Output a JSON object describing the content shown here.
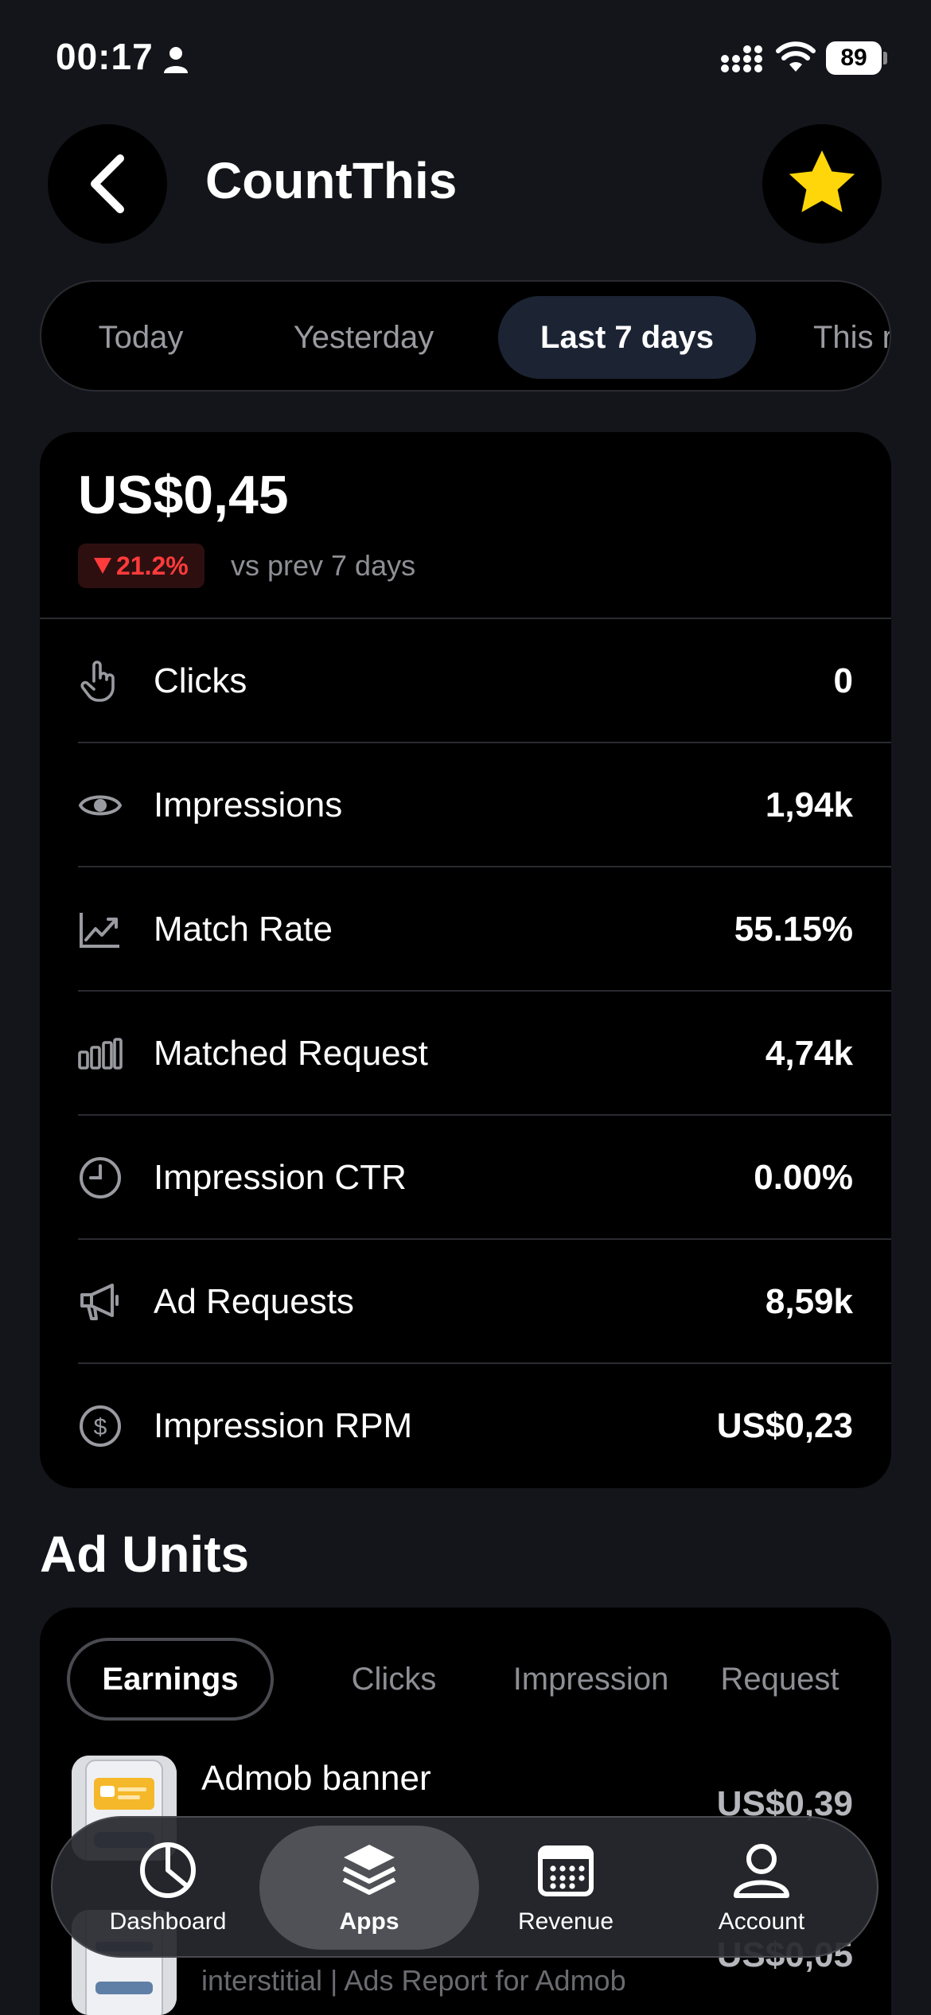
{
  "status_bar": {
    "time": "00:17",
    "battery": "89"
  },
  "header": {
    "title": "CountThis"
  },
  "period_tabs": [
    {
      "label": "Today"
    },
    {
      "label": "Yesterday"
    },
    {
      "label": "Last 7 days"
    },
    {
      "label": "This r"
    }
  ],
  "summary": {
    "amount": "US$0,45",
    "change": "21.2%",
    "change_direction": "down",
    "change_color": "#ff3b3b",
    "caption": "vs prev 7 days"
  },
  "metrics": [
    {
      "icon": "pointer-hand-icon",
      "label": "Clicks",
      "value": "0"
    },
    {
      "icon": "eye-icon",
      "label": "Impressions",
      "value": "1,94k"
    },
    {
      "icon": "trend-chart-icon",
      "label": "Match Rate",
      "value": "55.15%"
    },
    {
      "icon": "bars-icon",
      "label": "Matched Request",
      "value": "4,74k"
    },
    {
      "icon": "clock-icon",
      "label": "Impression CTR",
      "value": "0.00%"
    },
    {
      "icon": "megaphone-icon",
      "label": "Ad Requests",
      "value": "8,59k"
    },
    {
      "icon": "dollar-circle-icon",
      "label": "Impression RPM",
      "value": "US$0,23"
    }
  ],
  "ad_units": {
    "title": "Ad Units",
    "tabs": [
      {
        "label": "Earnings"
      },
      {
        "label": "Clicks"
      },
      {
        "label": "Impression"
      },
      {
        "label": "Request"
      }
    ],
    "items": [
      {
        "name": "Admob banner",
        "subtitle": "",
        "value": "US$0,39"
      },
      {
        "name": "",
        "subtitle": "interstitial | Ads Report for Admob",
        "value": "US$0,05"
      }
    ]
  },
  "tab_bar": [
    {
      "icon": "pie-chart-icon",
      "label": "Dashboard"
    },
    {
      "icon": "layers-icon",
      "label": "Apps"
    },
    {
      "icon": "calendar-icon",
      "label": "Revenue"
    },
    {
      "icon": "person-icon",
      "label": "Account"
    }
  ],
  "colors": {
    "accent_star": "#FFD60A",
    "background": "#14151b",
    "card": "#000000"
  }
}
